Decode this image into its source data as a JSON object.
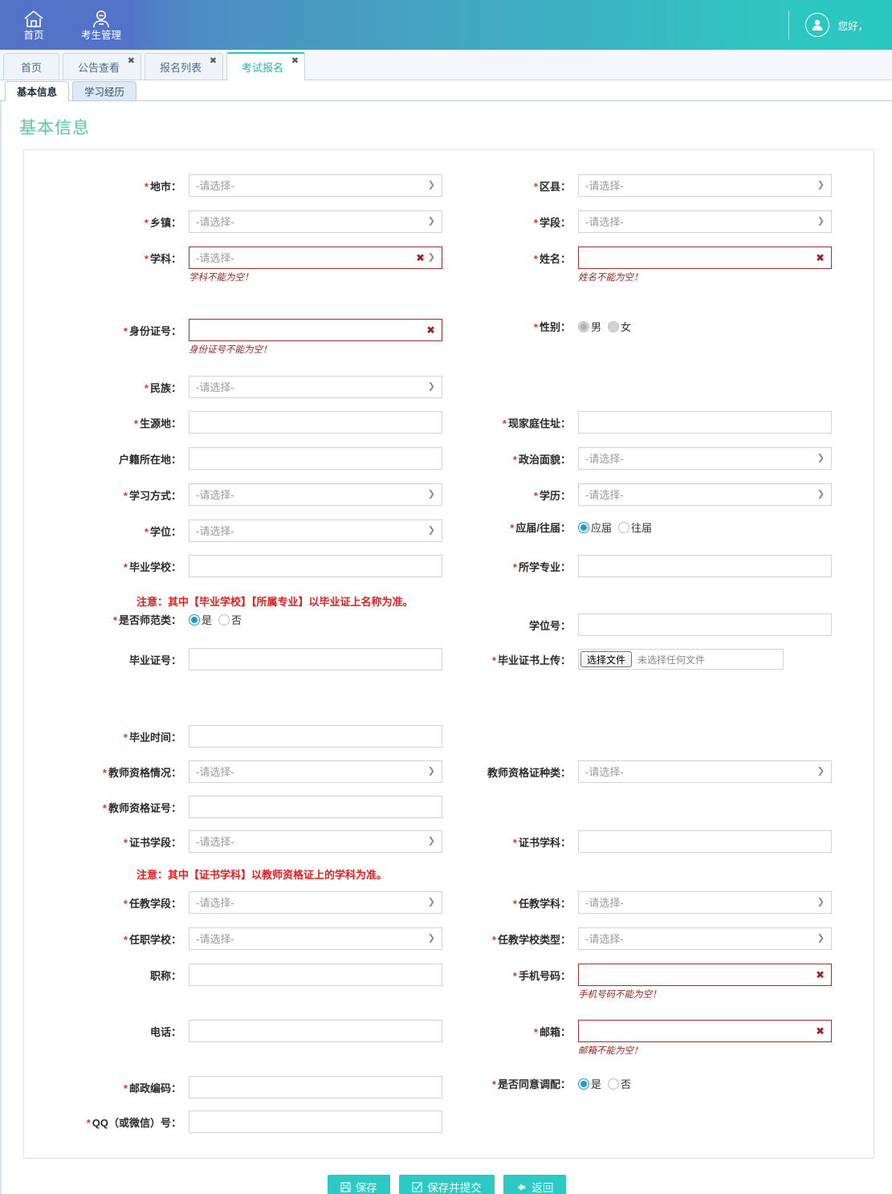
{
  "header": {
    "nav": [
      {
        "label": "首页",
        "icon": "home-icon"
      },
      {
        "label": "考生管理",
        "icon": "user-manage-icon"
      }
    ],
    "greeting": "您好，",
    "avatar_icon": "user-avatar-icon"
  },
  "tabs": [
    {
      "label": "首页",
      "closable": false,
      "active": false
    },
    {
      "label": "公告查看",
      "closable": true,
      "active": false
    },
    {
      "label": "报名列表",
      "closable": true,
      "active": false
    },
    {
      "label": "考试报名",
      "closable": true,
      "active": true
    }
  ],
  "subtabs": [
    {
      "label": "基本信息",
      "active": true
    },
    {
      "label": "学习经历",
      "active": false
    }
  ],
  "page_title": "基本信息",
  "placeholders": {
    "select": "-请选择-"
  },
  "file_upload": {
    "button": "选择文件",
    "status": "未选择任何文件"
  },
  "notices": {
    "school_major": "注意：其中【毕业学校】【所属专业】以毕业证上名称为准。",
    "cert_subject": "注意：其中【证书学科】以教师资格证上的学科为准。"
  },
  "fields": {
    "city": {
      "label": "地市",
      "required": true,
      "type": "select",
      "value": "-请选择-"
    },
    "district": {
      "label": "区县",
      "required": true,
      "type": "select",
      "value": "-请选择-"
    },
    "township": {
      "label": "乡镇",
      "required": true,
      "type": "select",
      "value": "-请选择-"
    },
    "stage": {
      "label": "学段",
      "required": true,
      "type": "select",
      "value": "-请选择-"
    },
    "subject": {
      "label": "学科",
      "required": true,
      "type": "select",
      "value": "-请选择-",
      "error": "学科不能为空！"
    },
    "name": {
      "label": "姓名",
      "required": true,
      "type": "text",
      "value": "",
      "error": "姓名不能为空！"
    },
    "idcard": {
      "label": "身份证号",
      "required": true,
      "type": "text",
      "value": "",
      "error": "身份证号不能为空！"
    },
    "gender": {
      "label": "性别",
      "required": true,
      "type": "radio",
      "options": [
        "男",
        "女"
      ],
      "selected": "男",
      "disabled": true
    },
    "nation": {
      "label": "民族",
      "required": true,
      "type": "select",
      "value": "-请选择-"
    },
    "origin": {
      "label": "生源地",
      "required": true,
      "type": "text",
      "value": ""
    },
    "home_address": {
      "label": "现家庭住址",
      "required": true,
      "type": "text",
      "value": ""
    },
    "household": {
      "label": "户籍所在地",
      "required": false,
      "type": "text",
      "value": ""
    },
    "political": {
      "label": "政治面貌",
      "required": true,
      "type": "select",
      "value": "-请选择-"
    },
    "study_mode": {
      "label": "学习方式",
      "required": true,
      "type": "select",
      "value": "-请选择-"
    },
    "education": {
      "label": "学历",
      "required": true,
      "type": "select",
      "value": "-请选择-"
    },
    "degree": {
      "label": "学位",
      "required": true,
      "type": "select",
      "value": "-请选择-"
    },
    "graduate_type": {
      "label": "应届/往届",
      "required": true,
      "type": "radio",
      "options": [
        "应届",
        "往届"
      ],
      "selected": "应届"
    },
    "grad_school": {
      "label": "毕业学校",
      "required": true,
      "type": "text",
      "value": ""
    },
    "major": {
      "label": "所学专业",
      "required": true,
      "type": "text",
      "value": ""
    },
    "is_normal": {
      "label": "是否师范类",
      "required": true,
      "type": "radio",
      "options": [
        "是",
        "否"
      ],
      "selected": "是"
    },
    "degree_no": {
      "label": "学位号",
      "required": false,
      "type": "text",
      "value": ""
    },
    "diploma_no": {
      "label": "毕业证号",
      "required": false,
      "type": "text",
      "value": ""
    },
    "diploma_upload": {
      "label": "毕业证书上传",
      "required": true,
      "type": "file"
    },
    "grad_time": {
      "label": "毕业时间",
      "required": true,
      "type": "text",
      "value": ""
    },
    "tq_status": {
      "label": "教师资格情况",
      "required": true,
      "type": "select",
      "value": "-请选择-"
    },
    "tq_cert_type": {
      "label": "教师资格证种类",
      "required": false,
      "type": "select",
      "value": "-请选择-"
    },
    "tq_cert_no": {
      "label": "教师资格证号",
      "required": true,
      "type": "text",
      "value": ""
    },
    "cert_stage": {
      "label": "证书学段",
      "required": true,
      "type": "select",
      "value": "-请选择-"
    },
    "cert_subject": {
      "label": "证书学科",
      "required": true,
      "type": "text",
      "value": ""
    },
    "teach_stage": {
      "label": "任教学段",
      "required": true,
      "type": "select",
      "value": "-请选择-"
    },
    "teach_subject": {
      "label": "任教学科",
      "required": true,
      "type": "select",
      "value": "-请选择-"
    },
    "work_school": {
      "label": "任职学校",
      "required": true,
      "type": "select",
      "value": "-请选择-"
    },
    "school_type": {
      "label": "任教学校类型",
      "required": true,
      "type": "select",
      "value": "-请选择-"
    },
    "title_rank": {
      "label": "职称",
      "required": false,
      "type": "text",
      "value": ""
    },
    "mobile": {
      "label": "手机号码",
      "required": true,
      "type": "text",
      "value": "",
      "error": "手机号码不能为空！"
    },
    "phone": {
      "label": "电话",
      "required": false,
      "type": "text",
      "value": ""
    },
    "email": {
      "label": "邮箱",
      "required": true,
      "type": "text",
      "value": "",
      "error": "邮箱不能为空！"
    },
    "postcode": {
      "label": "邮政编码",
      "required": true,
      "type": "text",
      "value": ""
    },
    "agree_adjust": {
      "label": "是否同意调配",
      "required": true,
      "type": "radio",
      "options": [
        "是",
        "否"
      ],
      "selected": "是"
    },
    "qq": {
      "label": "QQ（或微信）号",
      "required": true,
      "type": "text",
      "value": ""
    }
  },
  "footer": {
    "save": "保存",
    "save_submit": "保存并提交",
    "back": "返回"
  },
  "colors": {
    "header_start": "#5273c8",
    "header_end": "#2ac7c1",
    "accent_teal": "#2dc9c4",
    "title_green": "#5fc79f",
    "error_red": "#9c2222",
    "notice_red": "#e02020"
  }
}
